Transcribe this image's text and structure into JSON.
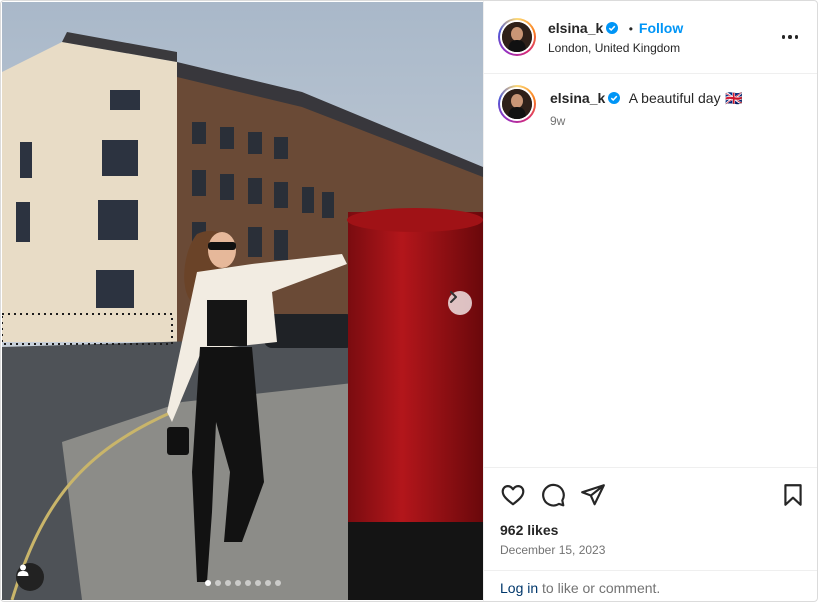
{
  "post": {
    "username": "elsina_k",
    "follow_label": "Follow",
    "separator": "•",
    "location": "London, United Kingdom",
    "caption": "A beautiful day",
    "caption_emoji": "🇬🇧",
    "time_ago": "9w",
    "likes": "962 likes",
    "date": "December 15, 2023",
    "login_link": "Log in",
    "login_suffix": " to like or comment."
  },
  "carousel": {
    "total_slides": 8,
    "active_index": 0
  },
  "icons": {
    "verified": "verified-badge-icon",
    "more": "more-options-icon",
    "like": "heart-icon",
    "comment": "comment-icon",
    "share": "paper-plane-icon",
    "save": "bookmark-icon",
    "next": "chevron-right-icon",
    "tags": "user-tag-icon"
  },
  "colors": {
    "accent": "#0095f6",
    "verified": "#0095f6",
    "link": "#00376b",
    "muted": "#737373"
  }
}
